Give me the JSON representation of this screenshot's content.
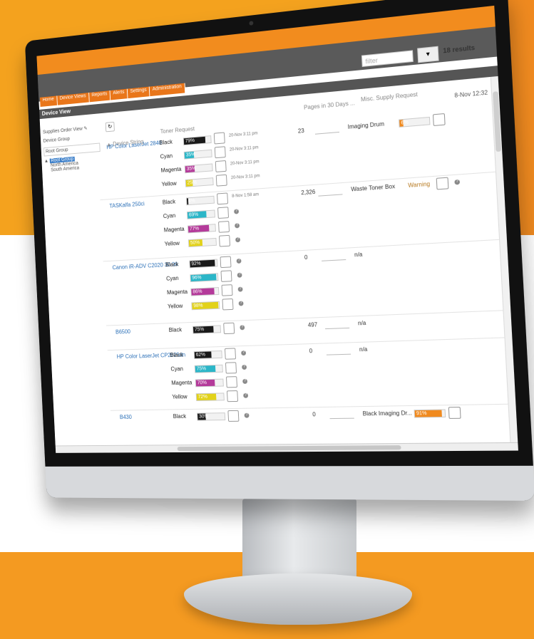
{
  "nav": [
    "Home",
    "Device Views",
    "Reports",
    "Alerts",
    "Settings",
    "Administration"
  ],
  "section_title": "Device View",
  "filter_placeholder": "filter",
  "results_text": "18 results",
  "sidebar": {
    "supplies_view": "Supplies Order View",
    "device_group_label": "Device Group",
    "device_group_value": "Root Group",
    "tree": [
      "Root Group",
      "North America",
      "South America"
    ]
  },
  "columns": {
    "device_string": "Device String",
    "toner_request": "Toner Request",
    "pages": "Pages in 30 Days ...",
    "misc": "Misc. Supply Request",
    "last_stamp": "8-Nov 12:32"
  },
  "devices": [
    {
      "name": "HP Color LaserJet 2840",
      "toners": [
        {
          "label": "Black",
          "pct": "79%",
          "color": "#1a1a1a",
          "stamp": "20-Nov 3:11 pm"
        },
        {
          "label": "Cyan",
          "pct": "35%",
          "color": "#2bb6c8",
          "stamp": "20-Nov 3:11 pm"
        },
        {
          "label": "Magenta",
          "pct": "35%",
          "color": "#b43a9a",
          "stamp": "20-Nov 3:11 pm"
        },
        {
          "label": "Yellow",
          "pct": "25%",
          "color": "#e2d21a",
          "stamp": "20-Nov 3:11 pm"
        }
      ],
      "pages": "23",
      "supply": "Imaging Drum",
      "supply_pct": "6%"
    },
    {
      "name": "TASKalfa 250ci",
      "toners": [
        {
          "label": "Black",
          "pct": "4%",
          "color": "#1a1a1a",
          "stamp": "8-Nov 1:58 am"
        },
        {
          "label": "Cyan",
          "pct": "69%",
          "color": "#2bb6c8"
        },
        {
          "label": "Magenta",
          "pct": "77%",
          "color": "#b43a9a"
        },
        {
          "label": "Yellow",
          "pct": "50%",
          "color": "#e2d21a"
        }
      ],
      "pages": "2,326",
      "supply": "Waste Toner Box",
      "supply_status": "Warning"
    },
    {
      "name": "Canon iR-ADV C2020 30.06",
      "toners": [
        {
          "label": "Black",
          "pct": "92%",
          "color": "#1a1a1a"
        },
        {
          "label": "Cyan",
          "pct": "96%",
          "color": "#2bb6c8"
        },
        {
          "label": "Magenta",
          "pct": "86%",
          "color": "#b43a9a"
        },
        {
          "label": "Yellow",
          "pct": "98%",
          "color": "#e2d21a"
        }
      ],
      "pages": "0",
      "supply": "n/a"
    },
    {
      "name": "B6500",
      "toners": [
        {
          "label": "Black",
          "pct": "75%",
          "color": "#1a1a1a"
        }
      ],
      "pages": "497",
      "supply": "n/a"
    },
    {
      "name": "HP Color LaserJet CP2025dn",
      "toners": [
        {
          "label": "Black",
          "pct": "62%",
          "color": "#1a1a1a"
        },
        {
          "label": "Cyan",
          "pct": "75%",
          "color": "#2bb6c8"
        },
        {
          "label": "Magenta",
          "pct": "70%",
          "color": "#b43a9a"
        },
        {
          "label": "Yellow",
          "pct": "72%",
          "color": "#e2d21a"
        }
      ],
      "pages": "0",
      "supply": "n/a"
    },
    {
      "name": "B430",
      "toners": [
        {
          "label": "Black",
          "pct": "30%",
          "color": "#1a1a1a"
        }
      ],
      "pages": "0",
      "supply": "Black Imaging Dr...",
      "supply_pct": "91%"
    }
  ]
}
